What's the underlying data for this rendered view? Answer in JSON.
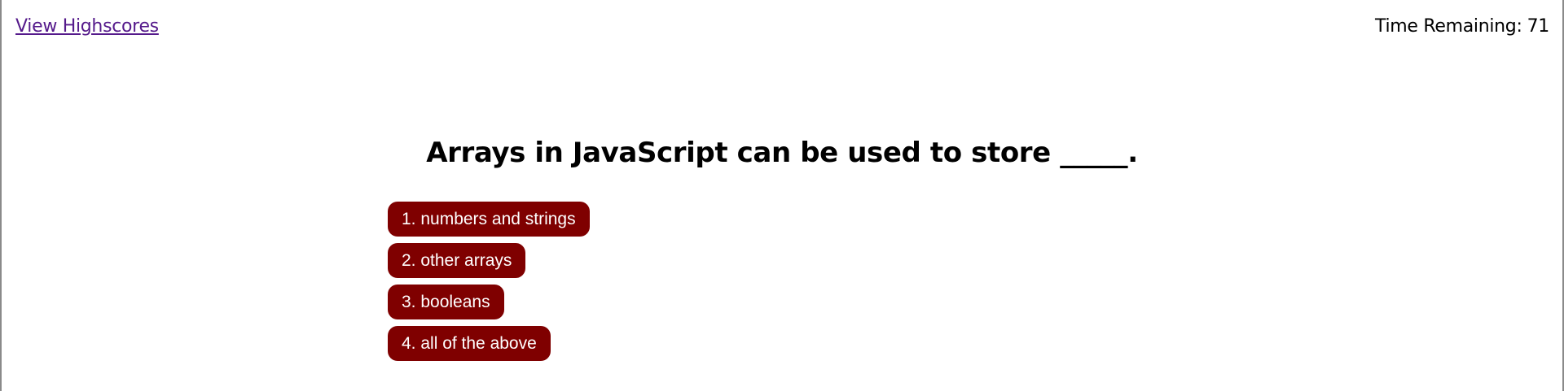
{
  "header": {
    "highscores_link": "View Highscores",
    "timer_label": "Time Remaining:",
    "timer_value": "71"
  },
  "quiz": {
    "question": "Arrays in JavaScript can be used to store _____.",
    "choices": [
      "1. numbers and strings",
      "2. other arrays",
      "3. booleans",
      "4. all of the above"
    ]
  },
  "colors": {
    "choice_background": "#7f0000",
    "choice_text": "#ffffff",
    "link": "#551a8b"
  }
}
